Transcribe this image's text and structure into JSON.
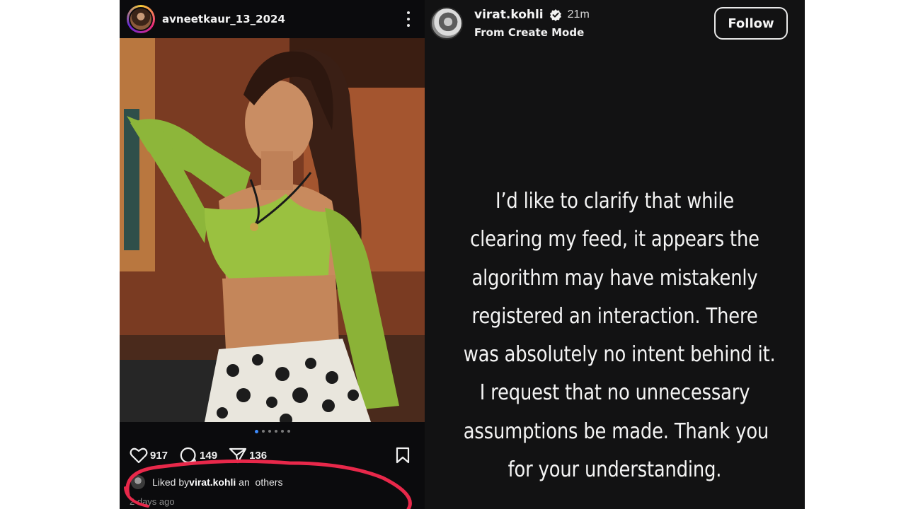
{
  "post": {
    "username": "avneetkaur_13_2024",
    "likes": "917",
    "comments": "149",
    "shares": "136",
    "liked_by_prefix": "Liked by ",
    "liked_by_user": "virat.kohli",
    "liked_by_suffix": " an  others",
    "time": "2 days ago",
    "carousel": {
      "count": 6,
      "active_index": 0
    }
  },
  "story": {
    "username": "virat.kohli",
    "time": "21m",
    "subtitle": "From Create Mode",
    "follow_label": "Follow",
    "lines": [
      "I’d like to clarify that while",
      "clearing my feed, it appears the",
      "algorithm may have mistakenly",
      "registered an interaction. There",
      "was absolutely no intent behind it.",
      "I request that no unnecessary",
      "assumptions be made. Thank you",
      "for your understanding."
    ]
  },
  "icons": {
    "more": "more-vertical-icon",
    "like": "heart-icon",
    "comment": "comment-icon",
    "share": "send-icon",
    "save": "bookmark-icon",
    "verified": "verified-badge-icon"
  },
  "colors": {
    "post_bg": "#0b0b0d",
    "story_bg": "#121213",
    "annotation": "#e8284a",
    "carousel_active": "#3d8bfd"
  }
}
